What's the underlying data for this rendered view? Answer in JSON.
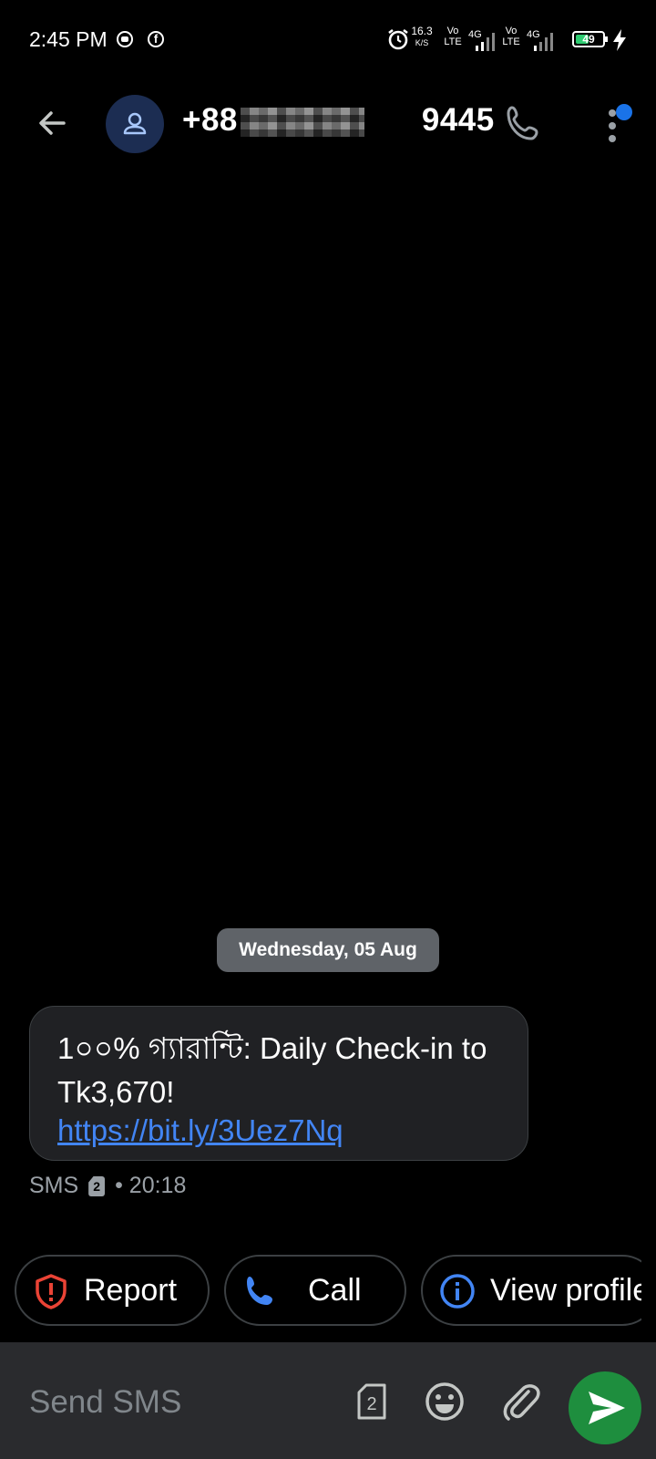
{
  "status_bar": {
    "time": "2:45 PM",
    "net_speed": "16.3",
    "net_speed_unit": "K/S",
    "volte_1_top": "Vo",
    "volte_1_bottom": "LTE",
    "net_type_1": "4G",
    "volte_2_top": "Vo",
    "volte_2_bottom": "LTE",
    "net_type_2": "4G",
    "battery_level": "49",
    "battery_fraction": 0.49
  },
  "header": {
    "contact_prefix": "+88",
    "contact_suffix": "9445"
  },
  "conversation": {
    "date_chip": "Wednesday, 05 Aug",
    "message": {
      "text": "1০০% গ্যারান্টি: Daily Check-in to Tk3,670!",
      "link": "https://bit.ly/3Uez7Nq",
      "channel": "SMS",
      "sim": "2",
      "time": "• 20:18"
    }
  },
  "quick_actions": [
    {
      "label": "Report",
      "icon": "shield-alert-icon",
      "color": "#ea4335"
    },
    {
      "label": "Call",
      "icon": "phone-icon",
      "color": "#4285f4"
    },
    {
      "label": "View profile",
      "icon": "info-icon",
      "color": "#4285f4"
    }
  ],
  "composer": {
    "placeholder": "Send SMS",
    "sim_number": "2"
  },
  "colors": {
    "background": "#000000",
    "bubble": "#202124",
    "link": "#4285f4",
    "send": "#1e8e3e",
    "notification_dot": "#1a73e8"
  }
}
